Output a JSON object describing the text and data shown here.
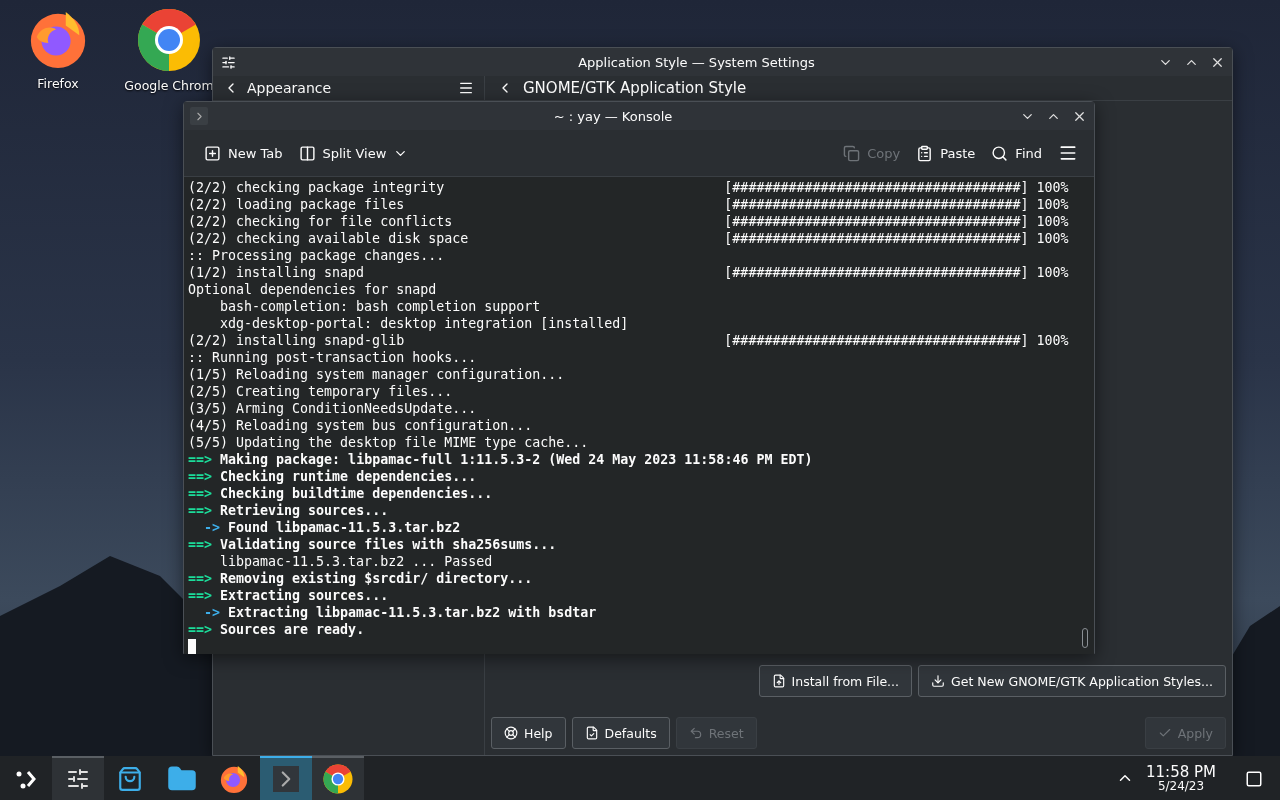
{
  "desktop_icons": [
    {
      "label": "Firefox",
      "kind": "firefox"
    },
    {
      "label": "Google Chrom",
      "kind": "chrome"
    }
  ],
  "settings_window": {
    "title": "Application Style — System Settings",
    "sidebar_header": "Appearance",
    "page_title": "GNOME/GTK Application Style",
    "actions": [
      {
        "label": "Install from File...",
        "kind": "file"
      },
      {
        "label": "Get New GNOME/GTK Application Styles...",
        "kind": "download"
      }
    ],
    "footer_buttons": [
      {
        "label": "Help",
        "kind": "help",
        "disabled": false
      },
      {
        "label": "Defaults",
        "kind": "defaults",
        "disabled": false
      },
      {
        "label": "Reset",
        "kind": "reset",
        "disabled": true
      },
      {
        "label": "Apply",
        "kind": "apply",
        "disabled": true
      }
    ]
  },
  "konsole": {
    "title": "~ : yay — Konsole",
    "toolbar_left": [
      {
        "label": "New Tab",
        "kind": "new-tab"
      },
      {
        "label": "Split View",
        "kind": "split-view"
      }
    ],
    "toolbar_right": [
      {
        "label": "Copy",
        "kind": "copy",
        "disabled": true
      },
      {
        "label": "Paste",
        "kind": "paste",
        "disabled": false
      },
      {
        "label": "Find",
        "kind": "find",
        "disabled": false
      }
    ],
    "lines": [
      {
        "kind": "progress",
        "text": "(2/2) checking package integrity",
        "bar": "[####################################]",
        "percent": "100%"
      },
      {
        "kind": "progress",
        "text": "(2/2) loading package files",
        "bar": "[####################################]",
        "percent": "100%"
      },
      {
        "kind": "progress",
        "text": "(2/2) checking for file conflicts",
        "bar": "[####################################]",
        "percent": "100%"
      },
      {
        "kind": "progress",
        "text": "(2/2) checking available disk space",
        "bar": "[####################################]",
        "percent": "100%"
      },
      {
        "kind": "plain",
        "text": ":: Processing package changes..."
      },
      {
        "kind": "progress",
        "text": "(1/2) installing snapd",
        "bar": "[####################################]",
        "percent": "100%"
      },
      {
        "kind": "plain",
        "text": "Optional dependencies for snapd"
      },
      {
        "kind": "plain",
        "text": "    bash-completion: bash completion support"
      },
      {
        "kind": "plain",
        "text": "    xdg-desktop-portal: desktop integration [installed]"
      },
      {
        "kind": "progress",
        "text": "(2/2) installing snapd-glib",
        "bar": "[####################################]",
        "percent": "100%"
      },
      {
        "kind": "plain",
        "text": ":: Running post-transaction hooks..."
      },
      {
        "kind": "plain",
        "text": "(1/5) Reloading system manager configuration..."
      },
      {
        "kind": "plain",
        "text": "(2/5) Creating temporary files..."
      },
      {
        "kind": "plain",
        "text": "(3/5) Arming ConditionNeedsUpdate..."
      },
      {
        "kind": "plain",
        "text": "(4/5) Reloading system bus configuration..."
      },
      {
        "kind": "plain",
        "text": "(5/5) Updating the desktop file MIME type cache..."
      },
      {
        "kind": "step",
        "marker": "==>",
        "text": "Making package: libpamac-full 1:11.5.3-2 (Wed 24 May 2023 11:58:46 PM EDT)"
      },
      {
        "kind": "step",
        "marker": "==>",
        "text": "Checking runtime dependencies..."
      },
      {
        "kind": "step",
        "marker": "==>",
        "text": "Checking buildtime dependencies..."
      },
      {
        "kind": "step",
        "marker": "==>",
        "text": "Retrieving sources..."
      },
      {
        "kind": "sub",
        "marker": "->",
        "text": "Found libpamac-11.5.3.tar.bz2"
      },
      {
        "kind": "step",
        "marker": "==>",
        "text": "Validating source files with sha256sums..."
      },
      {
        "kind": "plain",
        "text": "    libpamac-11.5.3.tar.bz2 ... Passed"
      },
      {
        "kind": "step",
        "marker": "==>",
        "text": "Removing existing $srcdir/ directory..."
      },
      {
        "kind": "step",
        "marker": "==>",
        "text": "Extracting sources..."
      },
      {
        "kind": "sub",
        "marker": "->",
        "text": "Extracting libpamac-11.5.3.tar.bz2 with bsdtar"
      },
      {
        "kind": "step",
        "marker": "==>",
        "text": "Sources are ready."
      }
    ]
  },
  "taskbar": {
    "apps": [
      {
        "kind": "settings",
        "open": true,
        "selected": false
      },
      {
        "kind": "store",
        "open": false,
        "selected": false
      },
      {
        "kind": "files",
        "open": false,
        "selected": false
      },
      {
        "kind": "firefox",
        "open": false,
        "selected": false
      },
      {
        "kind": "terminal",
        "open": true,
        "selected": true
      },
      {
        "kind": "chrome",
        "open": true,
        "selected": false
      }
    ],
    "time": "11:58 PM",
    "date": "5/24/23"
  }
}
